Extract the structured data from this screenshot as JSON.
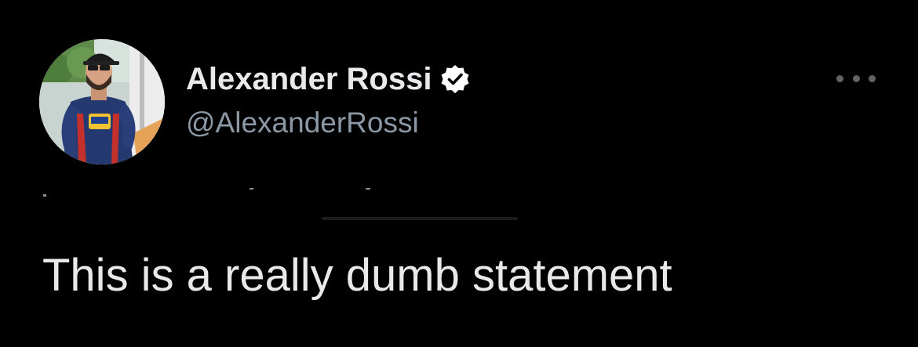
{
  "tweet": {
    "author": {
      "display_name": "Alexander Rossi",
      "handle": "@AlexanderRossi",
      "verified": true,
      "verified_icon": "verified-badge-icon"
    },
    "text": "This is a really dumb statement",
    "menu_icon": "more-options-icon"
  },
  "colors": {
    "background": "#000000",
    "name": "#e7e9ea",
    "handle": "#8b98a5",
    "menu_dots": "#5f6468"
  }
}
